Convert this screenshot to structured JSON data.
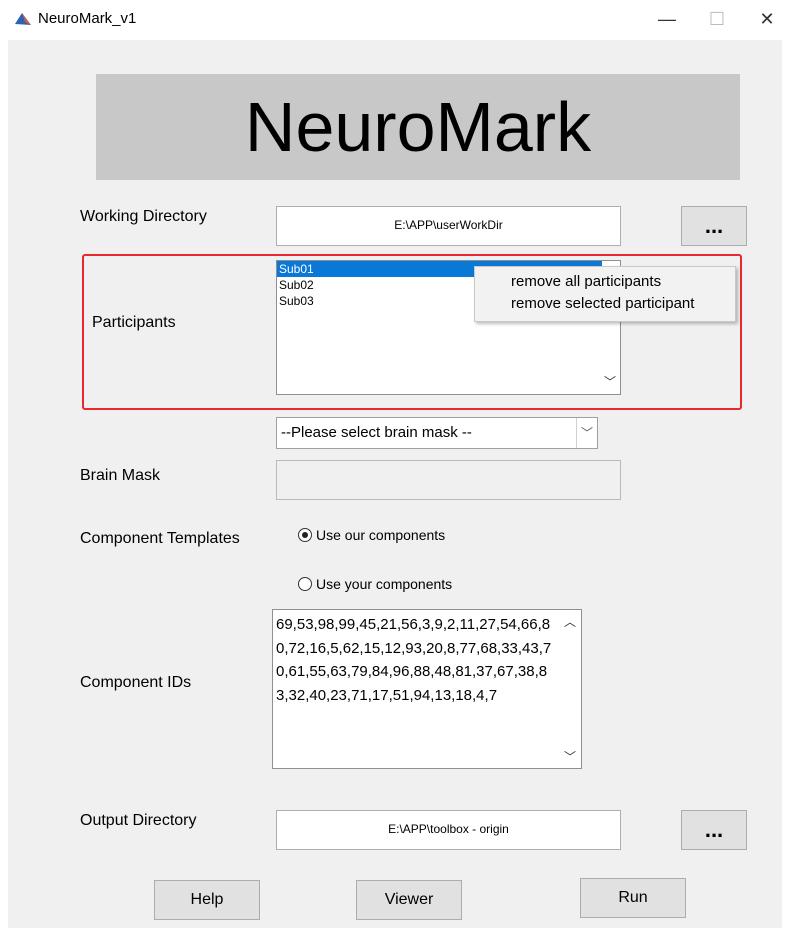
{
  "window": {
    "title": "NeuroMark_v1",
    "icons": [
      "matlab-icon",
      "minimize-icon",
      "maximize-icon",
      "close-icon"
    ]
  },
  "banner": {
    "text": "NeuroMark"
  },
  "working_directory": {
    "label": "Working Directory",
    "value": "E:\\APP\\userWorkDir",
    "browse_label": "..."
  },
  "participants": {
    "label": "Participants",
    "items": [
      "Sub01",
      "Sub02",
      "Sub03"
    ],
    "selected": "Sub01",
    "context_menu": [
      "remove all participants",
      "remove selected participant"
    ],
    "highlight_color": "#e8282c"
  },
  "brain_mask": {
    "label": "Brain Mask",
    "select_value": "--Please select brain mask --",
    "value": ""
  },
  "component_templates": {
    "label": "Component Templates",
    "options": [
      {
        "label": "Use our components",
        "checked": true
      },
      {
        "label": "Use your components",
        "checked": false
      }
    ]
  },
  "component_ids": {
    "label": "Component IDs",
    "value": "69,53,98,99,45,21,56,3,9,2,11,27,54,66,80,72,16,5,62,15,12,93,20,8,77,68,33,43,70,61,55,63,79,84,96,88,48,81,37,67,38,83,32,40,23,71,17,51,94,13,18,4,7"
  },
  "output_directory": {
    "label": "Output Directory",
    "value": "E:\\APP\\toolbox - origin",
    "browse_label": "..."
  },
  "buttons": {
    "help": "Help",
    "viewer": "Viewer",
    "run": "Run"
  },
  "colors": {
    "selection": "#0a78d7",
    "banner_bg": "#c8c8c8",
    "panel_bg": "#f0f0f0"
  }
}
